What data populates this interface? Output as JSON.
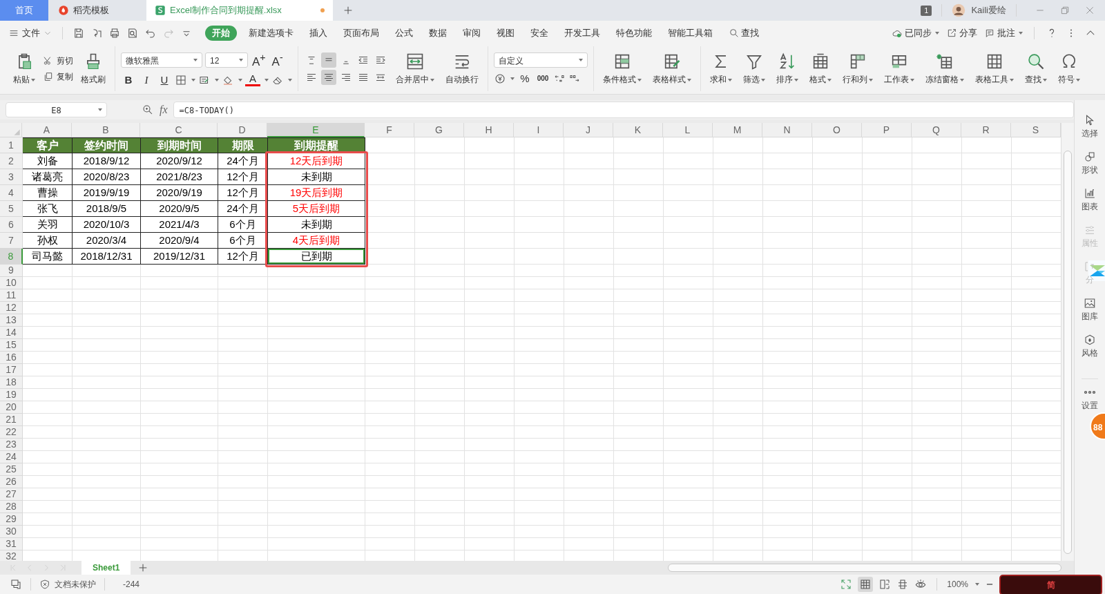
{
  "tabs": [
    {
      "label": "首页",
      "kind": "home",
      "selected": false,
      "unsaved": false
    },
    {
      "label": "稻壳模板",
      "kind": "docer",
      "selected": false,
      "unsaved": false
    },
    {
      "label": "Excel制作合同到期提醒.xlsx",
      "kind": "sheet",
      "selected": true,
      "unsaved": true
    }
  ],
  "title_bar": {
    "notification_count": "1",
    "user": "Kaili爱绘"
  },
  "menu": {
    "file": "文件",
    "items": [
      {
        "label": "开始",
        "selected": true
      },
      {
        "label": "新建选项卡",
        "selected": false
      },
      {
        "label": "插入",
        "selected": false
      },
      {
        "label": "页面布局",
        "selected": false
      },
      {
        "label": "公式",
        "selected": false
      },
      {
        "label": "数据",
        "selected": false
      },
      {
        "label": "审阅",
        "selected": false
      },
      {
        "label": "视图",
        "selected": false
      },
      {
        "label": "安全",
        "selected": false
      },
      {
        "label": "开发工具",
        "selected": false
      },
      {
        "label": "特色功能",
        "selected": false
      },
      {
        "label": "智能工具箱",
        "selected": false
      }
    ],
    "search": "查找",
    "right": [
      {
        "label": "已同步",
        "dropdown": true
      },
      {
        "label": "分享",
        "dropdown": false
      },
      {
        "label": "批注",
        "dropdown": true
      }
    ]
  },
  "ribbon": {
    "clipboard": [
      {
        "label": "粘贴",
        "dropdown": true
      },
      {
        "label": "剪切",
        "dropdown": false
      },
      {
        "label": "复制",
        "dropdown": false
      },
      {
        "label": "格式刷",
        "dropdown": false
      }
    ],
    "font": {
      "name": "微软雅黑",
      "size": "12",
      "size_buttons": [
        "A$^{+}$",
        "A$^{-}$"
      ],
      "style_buttons": [
        "B",
        "I",
        "U"
      ],
      "color_button": "A"
    },
    "align_buttons": [
      {
        "selected": false
      },
      {
        "selected": true
      },
      {
        "selected": false
      },
      {
        "selected": false
      },
      {
        "selected": false
      },
      {
        "selected": false
      },
      {
        "selected": true
      },
      {
        "selected": false
      },
      {
        "selected": false
      },
      {
        "selected": false
      }
    ],
    "merge": [
      {
        "label": "合并居中",
        "dropdown": true
      },
      {
        "label": "自动换行",
        "dropdown": false
      }
    ],
    "number": {
      "format": "自定义",
      "buttons": [
        "%",
        "000"
      ]
    },
    "styles": [
      {
        "label": "条件格式",
        "dropdown": true
      },
      {
        "label": "表格样式",
        "dropdown": true
      }
    ],
    "tools": [
      {
        "label": "求和",
        "dropdown": true
      },
      {
        "label": "筛选",
        "dropdown": true
      },
      {
        "label": "排序",
        "dropdown": true
      },
      {
        "label": "格式",
        "dropdown": true
      },
      {
        "label": "行和列",
        "dropdown": true
      },
      {
        "label": "工作表",
        "dropdown": true
      },
      {
        "label": "冻结窗格",
        "dropdown": true
      },
      {
        "label": "表格工具",
        "dropdown": true
      },
      {
        "label": "查找",
        "dropdown": true
      },
      {
        "label": "符号",
        "dropdown": true
      }
    ]
  },
  "formula_bar": {
    "name_box": "E8",
    "function_label": "fx",
    "formula": "=C8-TODAY()"
  },
  "sheet": {
    "columns": [
      {
        "label": "A",
        "selected": false
      },
      {
        "label": "B",
        "selected": false
      },
      {
        "label": "C",
        "selected": false
      },
      {
        "label": "D",
        "selected": false
      },
      {
        "label": "E",
        "selected": true
      },
      {
        "label": "F",
        "selected": false
      },
      {
        "label": "G",
        "selected": false
      },
      {
        "label": "H",
        "selected": false
      },
      {
        "label": "I",
        "selected": false
      },
      {
        "label": "J",
        "selected": false
      },
      {
        "label": "K",
        "selected": false
      },
      {
        "label": "L",
        "selected": false
      },
      {
        "label": "M",
        "selected": false
      },
      {
        "label": "N",
        "selected": false
      },
      {
        "label": "O",
        "selected": false
      },
      {
        "label": "P",
        "selected": false
      },
      {
        "label": "Q",
        "selected": false
      },
      {
        "label": "R",
        "selected": false
      },
      {
        "label": "S",
        "selected": false
      }
    ],
    "rows": [
      {
        "number": "1",
        "kind": "header",
        "selected": false,
        "cells": [
          "客户",
          "签约时间",
          "到期时间",
          "期限",
          "到期提醒"
        ]
      },
      {
        "number": "2",
        "kind": "data",
        "selected": false,
        "alert": true,
        "cells": [
          "刘备",
          "2018/9/12",
          "2020/9/12",
          "24个月",
          "12天后到期"
        ]
      },
      {
        "number": "3",
        "kind": "data",
        "selected": false,
        "alert": false,
        "cells": [
          "诸葛亮",
          "2020/8/23",
          "2021/8/23",
          "12个月",
          "未到期"
        ]
      },
      {
        "number": "4",
        "kind": "data",
        "selected": false,
        "alert": true,
        "cells": [
          "曹操",
          "2019/9/19",
          "2020/9/19",
          "12个月",
          "19天后到期"
        ]
      },
      {
        "number": "5",
        "kind": "data",
        "selected": false,
        "alert": true,
        "cells": [
          "张飞",
          "2018/9/5",
          "2020/9/5",
          "24个月",
          "5天后到期"
        ]
      },
      {
        "number": "6",
        "kind": "data",
        "selected": false,
        "alert": false,
        "cells": [
          "关羽",
          "2020/10/3",
          "2021/4/3",
          "6个月",
          "未到期"
        ]
      },
      {
        "number": "7",
        "kind": "data",
        "selected": false,
        "alert": true,
        "cells": [
          "孙权",
          "2020/3/4",
          "2020/9/4",
          "6个月",
          "4天后到期"
        ]
      },
      {
        "number": "8",
        "kind": "data",
        "selected": true,
        "alert": false,
        "cells": [
          "司马懿",
          "2018/12/31",
          "2019/12/31",
          "12个月",
          "已到期"
        ]
      }
    ],
    "empty_rows": [
      "9",
      "10",
      "11",
      "12",
      "13",
      "14",
      "15",
      "16",
      "17",
      "18",
      "19",
      "20",
      "21",
      "22",
      "23",
      "24",
      "25",
      "26",
      "27",
      "28",
      "29",
      "30",
      "31",
      "32"
    ]
  },
  "sheet_tabs": [
    {
      "label": "Sheet1",
      "selected": true
    }
  ],
  "side_panel": [
    {
      "label": "选择",
      "disabled": false
    },
    {
      "label": "形状",
      "disabled": false
    },
    {
      "label": "图表",
      "disabled": false
    },
    {
      "label": "属性",
      "disabled": true
    },
    {
      "label": "分",
      "disabled": true
    },
    {
      "label": "图库",
      "disabled": false
    },
    {
      "label": "风格",
      "disabled": false
    },
    {
      "label": "设置",
      "disabled": false
    }
  ],
  "floating_ball": "88",
  "status_bar": {
    "protection": "文档未保护",
    "value": "-244",
    "zoom": "100%"
  },
  "input_method": "简"
}
